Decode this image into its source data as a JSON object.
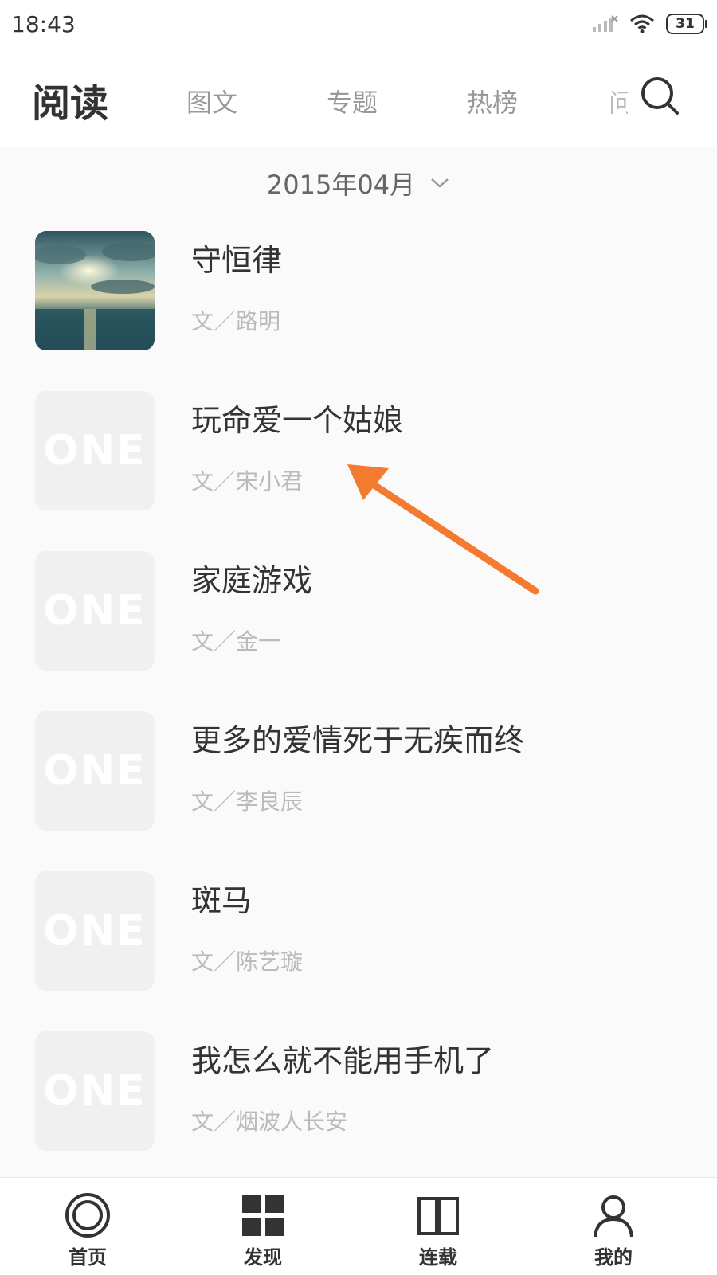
{
  "status_bar": {
    "time": "18:43",
    "battery": "31"
  },
  "header": {
    "title": "阅读",
    "tabs": [
      {
        "label": "图文"
      },
      {
        "label": "专题"
      },
      {
        "label": "热榜"
      },
      {
        "label": "问"
      }
    ]
  },
  "date_selector": {
    "label": "2015年04月"
  },
  "thumb_placeholder": "ONE",
  "articles": [
    {
      "title": "守恒律",
      "author": "文／路明"
    },
    {
      "title": "玩命爱一个姑娘",
      "author": "文／宋小君"
    },
    {
      "title": "家庭游戏",
      "author": "文／金一"
    },
    {
      "title": "更多的爱情死于无疾而终",
      "author": "文／李良辰"
    },
    {
      "title": "斑马",
      "author": "文／陈艺璇"
    },
    {
      "title": "我怎么就不能用手机了",
      "author": "文／烟波人长安"
    }
  ],
  "bottom_nav": [
    {
      "label": "首页",
      "icon": "home-circle-icon"
    },
    {
      "label": "发现",
      "icon": "grid-icon"
    },
    {
      "label": "连载",
      "icon": "book-icon"
    },
    {
      "label": "我的",
      "icon": "person-icon"
    }
  ],
  "colors": {
    "accent_arrow": "#f47a2f",
    "background": "#fafafa"
  }
}
